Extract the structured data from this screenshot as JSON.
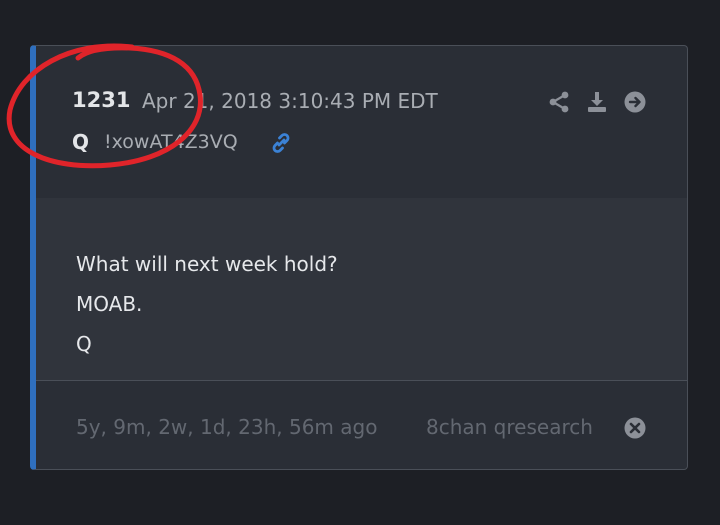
{
  "post": {
    "number": "1231",
    "date": "Apr 21, 2018 3:10:43 PM EDT",
    "author": "Q",
    "tripcode": "!xowAT4Z3VQ",
    "body_lines": [
      "What will next week hold?",
      "MOAB.",
      "Q"
    ],
    "age": "5y, 9m, 2w, 1d, 23h, 56m ago",
    "source": "8chan qresearch"
  },
  "icons": {
    "link": "link-icon",
    "share": "share-icon",
    "download": "download-icon",
    "goto": "arrow-circle-right-icon",
    "close": "close-circle-icon"
  },
  "colors": {
    "accent": "#2f6fbe",
    "link": "#3b82d6",
    "annotation": "#e0242a"
  }
}
